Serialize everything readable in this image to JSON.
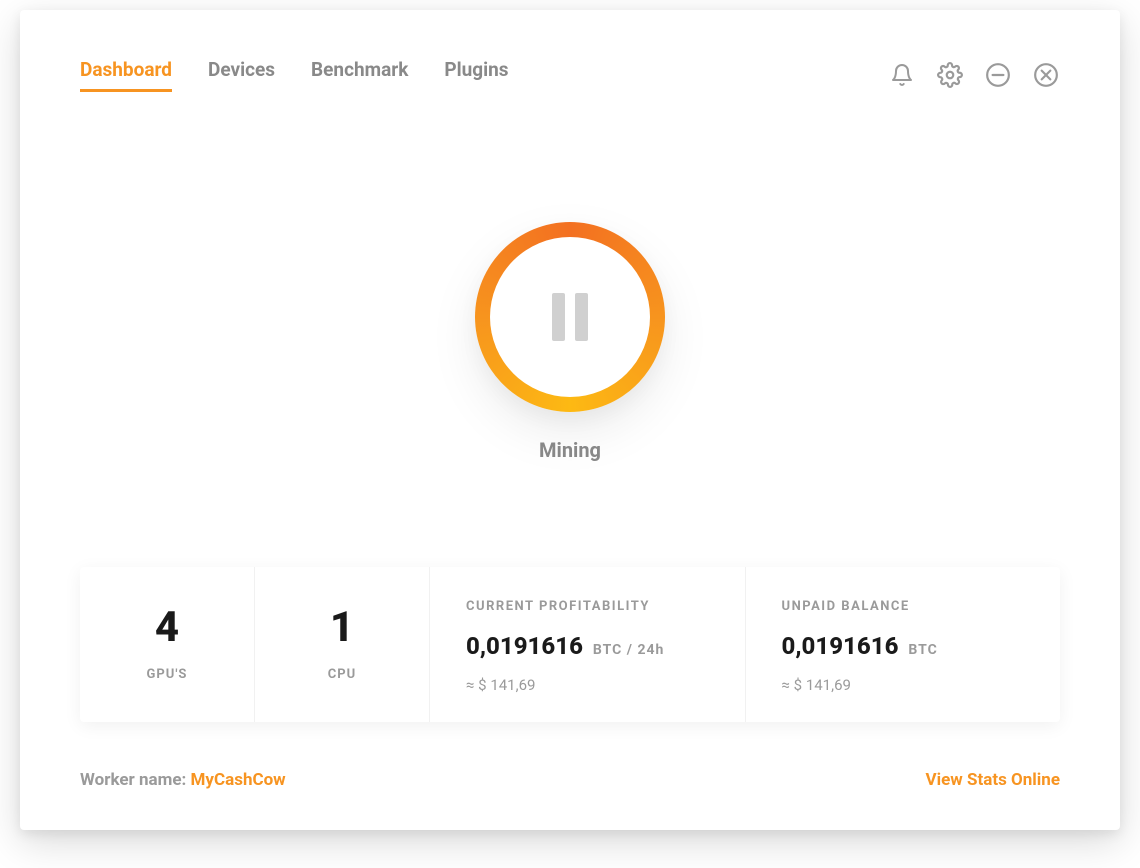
{
  "nav": {
    "tabs": [
      {
        "label": "Dashboard",
        "active": true
      },
      {
        "label": "Devices",
        "active": false
      },
      {
        "label": "Benchmark",
        "active": false
      },
      {
        "label": "Plugins",
        "active": false
      }
    ]
  },
  "icons": {
    "bell": "bell-icon",
    "gear": "gear-icon",
    "minimize": "minimize-icon",
    "close": "close-icon"
  },
  "mining": {
    "status_label": "Mining"
  },
  "stats": {
    "gpu": {
      "count": "4",
      "label": "GPU'S"
    },
    "cpu": {
      "count": "1",
      "label": "CPU"
    },
    "profitability": {
      "heading": "CURRENT PROFITABILITY",
      "value": "0,0191616",
      "unit": "BTC  / 24h",
      "usd": "≈ $ 141,69"
    },
    "balance": {
      "heading": "UNPAID BALANCE",
      "value": "0,0191616",
      "unit": "BTC",
      "usd": "≈ $ 141,69"
    }
  },
  "footer": {
    "worker_label": "Worker name: ",
    "worker_name": "MyCashCow",
    "view_stats": "View Stats Online"
  },
  "colors": {
    "accent": "#F79421",
    "muted": "#9a9a9a"
  }
}
